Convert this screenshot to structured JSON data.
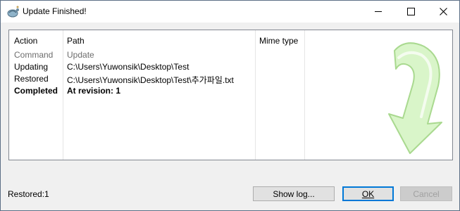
{
  "window": {
    "title": "Update Finished!"
  },
  "table": {
    "columns": [
      "Action",
      "Path",
      "Mime type"
    ],
    "rows": [
      {
        "action": "Command",
        "path": "Update",
        "style": "gray"
      },
      {
        "action": "Updating",
        "path": "C:\\Users\\Yuwonsik\\Desktop\\Test",
        "style": "normal"
      },
      {
        "action": "Restored",
        "path": "C:\\Users\\Yuwonsik\\Desktop\\Test\\추가파일.txt",
        "style": "normal"
      },
      {
        "action": "Completed",
        "path": "At revision: 1",
        "style": "bold"
      }
    ]
  },
  "status": {
    "text": "Restored:1"
  },
  "buttons": {
    "show_log": "Show log...",
    "ok": "OK",
    "cancel": "Cancel"
  },
  "icons": {
    "app": "tortoise-icon",
    "minimize": "minimize-icon",
    "maximize": "maximize-icon",
    "close": "close-icon",
    "success": "curved-arrow-down-icon"
  },
  "colors": {
    "arrow_fill": "#d9f5c9",
    "arrow_stroke": "#a9d98f",
    "ok_border": "#0078d7"
  }
}
